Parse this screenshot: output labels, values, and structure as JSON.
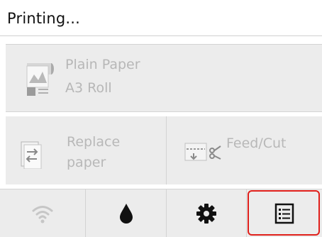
{
  "status": {
    "title": "Printing..."
  },
  "media": {
    "type": "Plain Paper",
    "size": "A3 Roll",
    "icon": "roll-paper-icon"
  },
  "actions": {
    "replace_line1": "Replace",
    "replace_line2": "paper",
    "feed_cut": "Feed/Cut"
  },
  "tabs": [
    {
      "name": "wifi",
      "icon": "wifi-icon"
    },
    {
      "name": "ink",
      "icon": "ink-drop-icon"
    },
    {
      "name": "setup",
      "icon": "gear-icon"
    },
    {
      "name": "jobs",
      "icon": "job-list-icon"
    }
  ],
  "colors": {
    "highlight": "#e0201b",
    "disabled_text": "#b7b7b7",
    "panel": "#ececec"
  }
}
